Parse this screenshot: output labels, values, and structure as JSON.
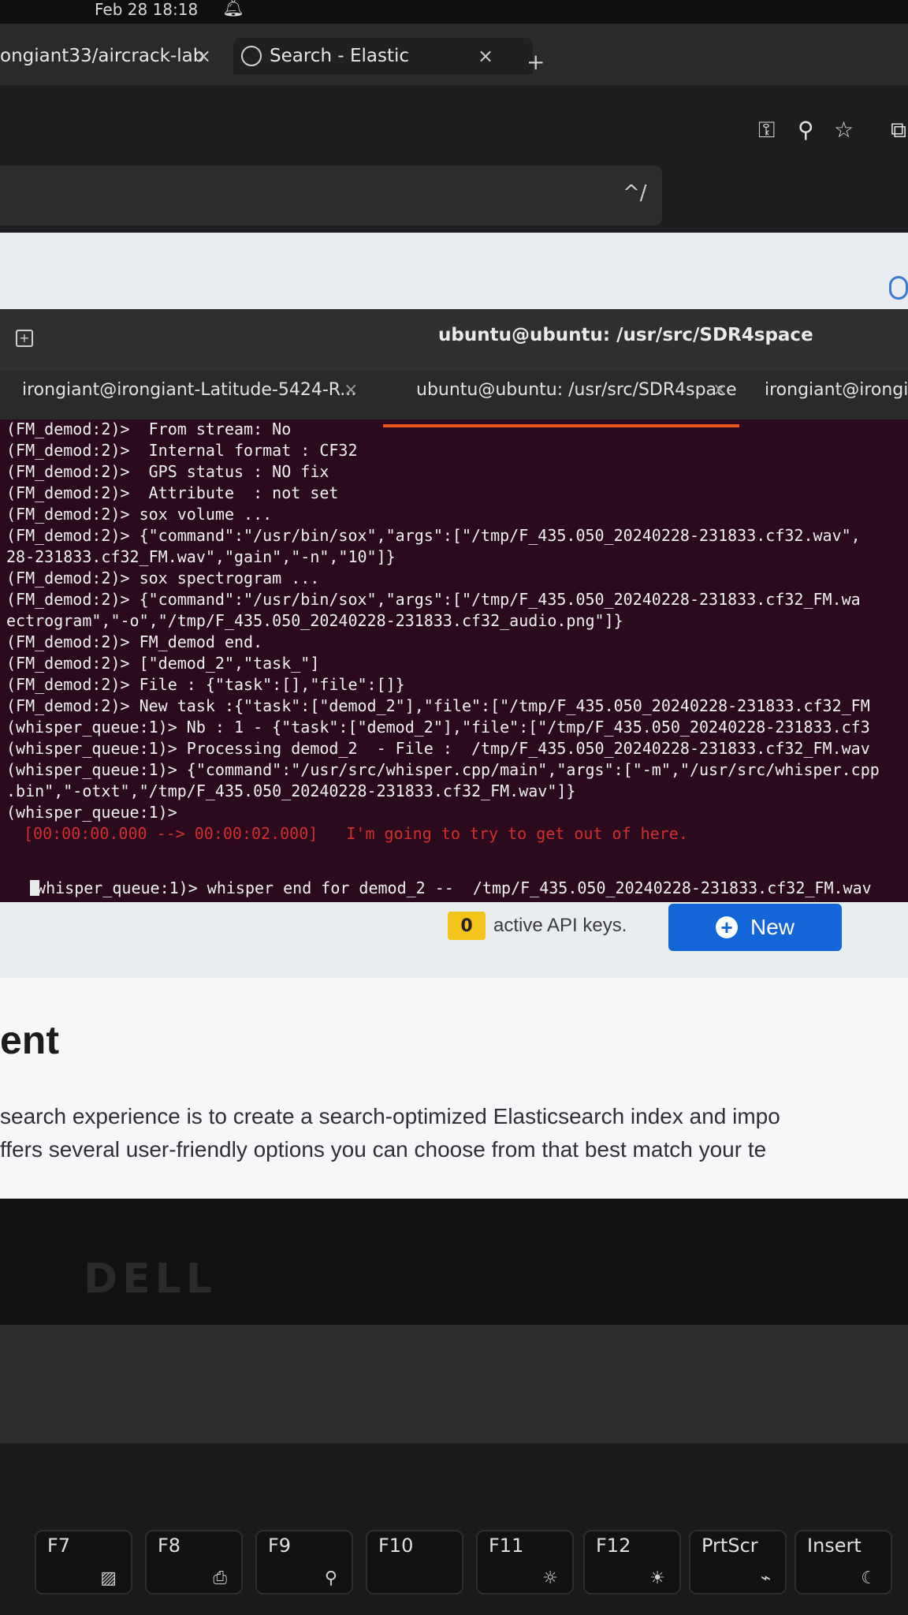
{
  "system": {
    "clock": "Feb 28  18:18",
    "bell_icon": "bell-icon"
  },
  "browser": {
    "tabs": [
      {
        "label": "ongiant33/aircrack-lab"
      },
      {
        "label": "Search - Elastic"
      }
    ],
    "close_glyph": "×",
    "new_tab_glyph": "+",
    "kbd_hint": "^/"
  },
  "page": {
    "api_count": "0",
    "api_text": "active API keys.",
    "new_button": "New",
    "heading": "ent",
    "para1": "search experience is to create a search-optimized Elasticsearch index and impo",
    "para2": "ffers several user-friendly options you can choose from that best match your te"
  },
  "terminal": {
    "title": "ubuntu@ubuntu: /usr/src/SDR4space",
    "tabs": [
      {
        "label": "irongiant@irongiant-Latitude-5424-R..."
      },
      {
        "label": "ubuntu@ubuntu: /usr/src/SDR4space"
      },
      {
        "label": "irongiant@irongian"
      }
    ],
    "lines": [
      "(FM_demod:2)>  From stream: No",
      "(FM_demod:2)>  Internal format : CF32",
      "(FM_demod:2)>  GPS status : NO fix",
      "(FM_demod:2)>  Attribute  : not set",
      "(FM_demod:2)> sox volume ...",
      "(FM_demod:2)> {\"command\":\"/usr/bin/sox\",\"args\":[\"/tmp/F_435.050_20240228-231833.cf32.wav\",",
      "28-231833.cf32_FM.wav\",\"gain\",\"-n\",\"10\"]}",
      "(FM_demod:2)> sox spectrogram ...",
      "(FM_demod:2)> {\"command\":\"/usr/bin/sox\",\"args\":[\"/tmp/F_435.050_20240228-231833.cf32_FM.wa",
      "ectrogram\",\"-o\",\"/tmp/F_435.050_20240228-231833.cf32_audio.png\"]}",
      "(FM_demod:2)> FM_demod end.",
      "(FM_demod:2)> [\"demod_2\",\"task_\"]",
      "(FM_demod:2)> File : {\"task\":[],\"file\":[]}",
      "(FM_demod:2)> New task :{\"task\":[\"demod_2\"],\"file\":[\"/tmp/F_435.050_20240228-231833.cf32_FM",
      "(whisper_queue:1)> Nb : 1 - {\"task\":[\"demod_2\"],\"file\":[\"/tmp/F_435.050_20240228-231833.cf3",
      "(whisper_queue:1)> Processing demod_2  - File :  /tmp/F_435.050_20240228-231833.cf32_FM.wav",
      "(whisper_queue:1)> {\"command\":\"/usr/src/whisper.cpp/main\",\"args\":[\"-m\",\"/usr/src/whisper.cpp",
      ".bin\",\"-otxt\",\"/tmp/F_435.050_20240228-231833.cf32_FM.wav\"]}",
      "(whisper_queue:1)>",
      "[00:00:00.000 --> 00:00:02.000]   I'm going to try to get out of here.",
      "(whisper_queue:1)> whisper end for demod_2 --  /tmp/F_435.050_20240228-231833.cf32_FM.wav"
    ]
  },
  "laptop": {
    "brand": "DELL"
  },
  "keyboard": {
    "keys": [
      {
        "label": "F7",
        "glyph": "▨"
      },
      {
        "label": "F8",
        "glyph": "⎙"
      },
      {
        "label": "F9",
        "glyph": "⚲"
      },
      {
        "label": "F10",
        "glyph": ""
      },
      {
        "label": "F11",
        "glyph": "☼"
      },
      {
        "label": "F12",
        "glyph": "☀"
      },
      {
        "label": "PrtScr",
        "glyph": "⌁"
      },
      {
        "label": "Insert",
        "glyph": "☾"
      }
    ]
  }
}
